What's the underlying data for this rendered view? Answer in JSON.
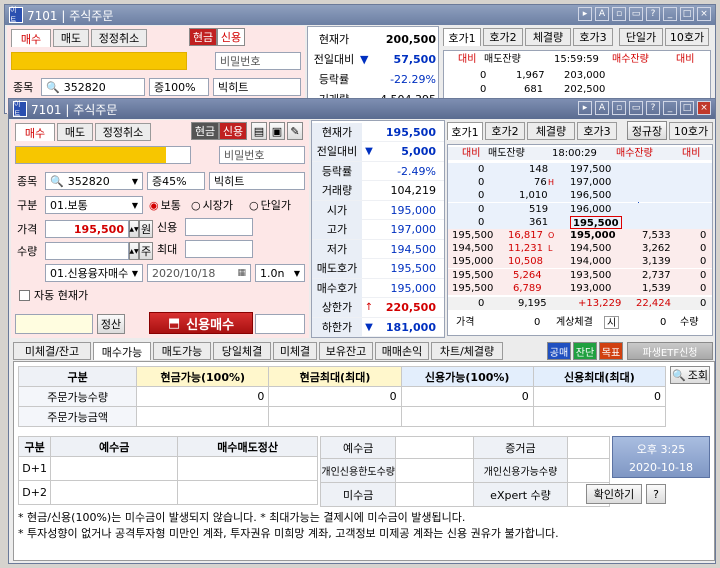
{
  "back": {
    "title": "7101 | 주식주문",
    "logo": "이트",
    "tabs": [
      "매수",
      "매도",
      "정정취소"
    ],
    "cash": "현금",
    "credit": "신용",
    "password": "비밀번호",
    "stock_label": "종목",
    "stock_code": "352820",
    "rate": "증100%",
    "stock_name": "빅히트",
    "price_rows": [
      [
        "현재가",
        "200,500"
      ],
      [
        "전일대비",
        "57,500"
      ],
      [
        "등락률",
        "-22.29%"
      ],
      [
        "거래량",
        "4,504,395"
      ]
    ],
    "hoga_tabs": [
      "호가1",
      "호가2",
      "체결량",
      "호가3",
      "단일가",
      "10호가"
    ],
    "ob_head": [
      "대비",
      "매도잔량",
      "15:59:59",
      "매수잔량",
      "대비"
    ],
    "ob_rows": [
      [
        "0",
        "1,967",
        "203,000"
      ],
      [
        "0",
        "681",
        "202,500"
      ]
    ]
  },
  "front": {
    "title": "7101 | 주식주문",
    "logo": "이트",
    "tabs": [
      "매수",
      "매도",
      "정정취소"
    ],
    "cash": "현금",
    "credit": "신용",
    "password": "비밀번호",
    "stock_label": "종목",
    "stock_code": "352820",
    "rate": "증45%",
    "stock_name": "빅히트",
    "type_label": "구분",
    "type_value": "01.보통",
    "radios": [
      "보통",
      "시장가",
      "단일가"
    ],
    "price_label": "가격",
    "price_value": "195,500",
    "won": "원",
    "qty_label": "수량",
    "ju": "주",
    "credit_label": "신용",
    "max_label": "최대",
    "loan_type": "01.신용융자매수",
    "date": "2020/10/18",
    "period": "1.0n",
    "auto_price": "자동 현재가",
    "jeongsan": "정산",
    "buy_button": "신용매수",
    "price_rows": [
      [
        "현재가",
        "195,500",
        ""
      ],
      [
        "전일대비",
        "5,000",
        "down"
      ],
      [
        "등락률",
        "-2.49%",
        ""
      ],
      [
        "거래량",
        "104,219",
        ""
      ],
      [
        "시가",
        "195,000",
        ""
      ],
      [
        "고가",
        "197,000",
        ""
      ],
      [
        "저가",
        "194,500",
        ""
      ],
      [
        "매도호가",
        "195,500",
        ""
      ],
      [
        "매수호가",
        "195,000",
        ""
      ],
      [
        "상한가",
        "220,500",
        "up"
      ],
      [
        "하한가",
        "181,000",
        "down"
      ]
    ],
    "hoga_tabs": [
      "호가1",
      "호가2",
      "체결량",
      "호가3",
      "정규장",
      "10호가"
    ],
    "ob_head": [
      "대비",
      "매도잔량",
      "18:00:29",
      "매수잔량",
      "대비"
    ],
    "ask_rows": [
      [
        "0",
        "148",
        "197,500",
        ""
      ],
      [
        "0",
        "76",
        "197,000",
        "H"
      ],
      [
        "0",
        "1,010",
        "196,500",
        ""
      ],
      [
        "0",
        "519",
        "196,000",
        ""
      ],
      [
        "0",
        "361",
        "195,500",
        ""
      ]
    ],
    "bid_rows": [
      [
        "195,500",
        "16,817",
        "195,000",
        "O",
        "7,533",
        "0"
      ],
      [
        "194,500",
        "11,231",
        "194,500",
        "L",
        "3,262",
        "0"
      ],
      [
        "195,000",
        "10,508",
        "194,000",
        "",
        "3,139",
        "0"
      ],
      [
        "195,500",
        "5,264",
        "193,500",
        "",
        "2,737",
        "0"
      ],
      [
        "195,500",
        "6,789",
        "193,000",
        "",
        "1,539",
        "0"
      ]
    ],
    "ob_total": [
      "0",
      "9,195",
      "+13,229",
      "22,424",
      "0"
    ],
    "ob_footer": [
      "가격",
      "0",
      "계상체결",
      "시",
      "0",
      "수량"
    ]
  },
  "bottom": {
    "tabs": [
      "미체결/잔고",
      "매수가능",
      "매도가능",
      "당일체결",
      "미체결",
      "보유잔고",
      "매매손익",
      "차트/체결량"
    ],
    "color_btns": [
      "공매",
      "잔단",
      "목표"
    ],
    "right_tab": "파생ETF신청",
    "grid_head": [
      "구분",
      "현금가능(100%)",
      "현금최대(최대)",
      "신용가능(100%)",
      "신용최대(최대)"
    ],
    "grid_rows": [
      [
        "주문가능수량",
        "0",
        "0",
        "0",
        "0"
      ],
      [
        "주문가능금액",
        "",
        "",
        "",
        ""
      ]
    ],
    "search": "조회",
    "left_head": [
      "구분",
      "예수금",
      "매수매도정산"
    ],
    "left_rows": [
      "D+1",
      "D+2"
    ],
    "mid_labels": [
      "예수금",
      "개인신용한도수량",
      "미수금"
    ],
    "right_labels": [
      "증거금",
      "개인신용가능수량",
      "eXpert 수량"
    ],
    "confirm": "확인하기",
    "help": "?",
    "clock_time": "오후 3:25",
    "clock_date": "2020-10-18",
    "notes": [
      "* 현금/신용(100%)는 미수금이 발생되지 않습니다. * 최대가능는 결제시에 미수금이 발생됩니다.",
      "* 투자성향이 없거나 공격투자형 미만인 계좌, 투자권유 미희망 계좌, 고객정보 미제공 계좌는 신용 권유가 불가합니다."
    ]
  },
  "colors": {
    "accent_red": "#d20000",
    "accent_blue": "#0030c0",
    "pink": "#fde7e7",
    "yellow": "#f7c600"
  }
}
